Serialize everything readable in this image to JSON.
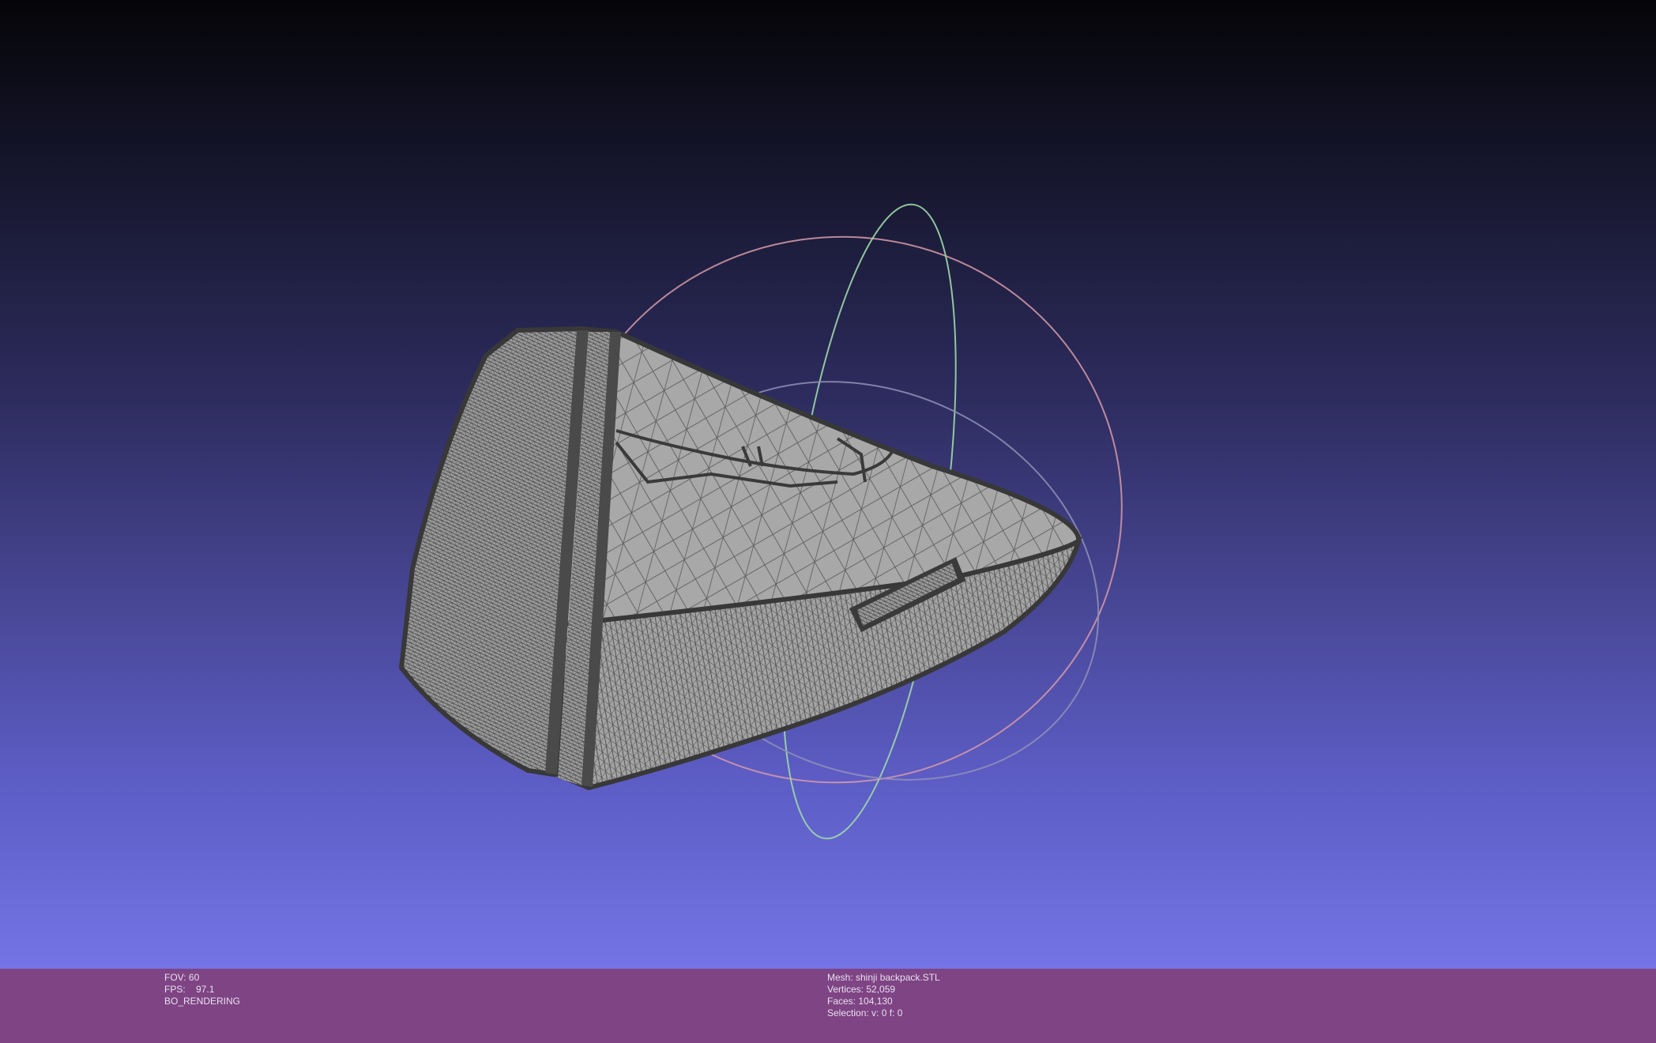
{
  "viewport": {
    "background_top": "#050508",
    "background_bottom": "#7474e6",
    "mesh_fill": "#a0a0a0",
    "wire_color": "#3c3c3c",
    "trackball_colors": [
      "#d79aa8",
      "#9dd8a8",
      "#8f90b8"
    ]
  },
  "status_left": {
    "fov": "FOV: 60",
    "fps": "FPS:    97.1",
    "mode": "BO_RENDERING"
  },
  "status_right": {
    "mesh": "Mesh: shinji backpack.STL",
    "vertices": "Vertices: 52,059",
    "faces": "Faces: 104,130",
    "selection": "Selection: v: 0 f: 0"
  },
  "info_bar_color": "#7e4484"
}
